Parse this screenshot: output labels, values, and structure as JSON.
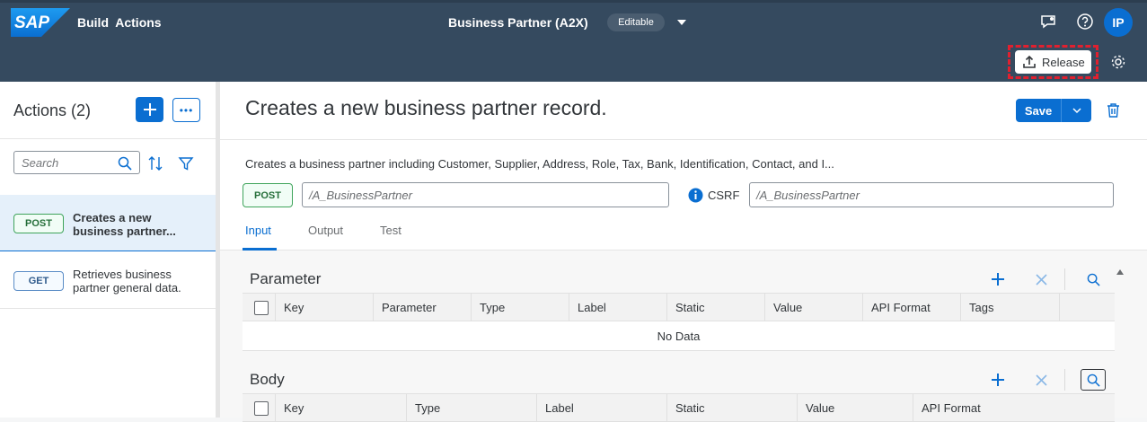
{
  "shell": {
    "logo": "SAP",
    "app_title": "Build  Actions",
    "center_title": "Business Partner (A2X)",
    "badge": "Editable",
    "avatar": "IP",
    "release_label": "Release"
  },
  "left": {
    "title": "Actions (2)",
    "more": "•••",
    "search_placeholder": "Search",
    "items": [
      {
        "method": "POST",
        "text": "Creates a new business partner..."
      },
      {
        "method": "GET",
        "text": "Retrieves business partner general data."
      }
    ]
  },
  "main": {
    "title": "Creates a new business partner record.",
    "save_label": "Save",
    "description": "Creates a business partner including Customer, Supplier, Address, Role, Tax, Bank, Identification, Contact, and I...",
    "method": "POST",
    "path": "/A_BusinessPartner",
    "csrf_label": "CSRF",
    "csrf_path": "/A_BusinessPartner",
    "tabs": [
      "Input",
      "Output",
      "Test"
    ],
    "parameter": {
      "title": "Parameter",
      "columns": [
        "Key",
        "Parameter",
        "Type",
        "Label",
        "Static",
        "Value",
        "API Format",
        "Tags"
      ],
      "empty_text": "No Data"
    },
    "body": {
      "title": "Body",
      "columns": [
        "Key",
        "Type",
        "Label",
        "Static",
        "Value",
        "API Format"
      ]
    }
  },
  "colors": {
    "shell": "#354a5f",
    "accent": "#0a6ed1",
    "highlight": "#e0202f",
    "post": "#3fa45b"
  }
}
